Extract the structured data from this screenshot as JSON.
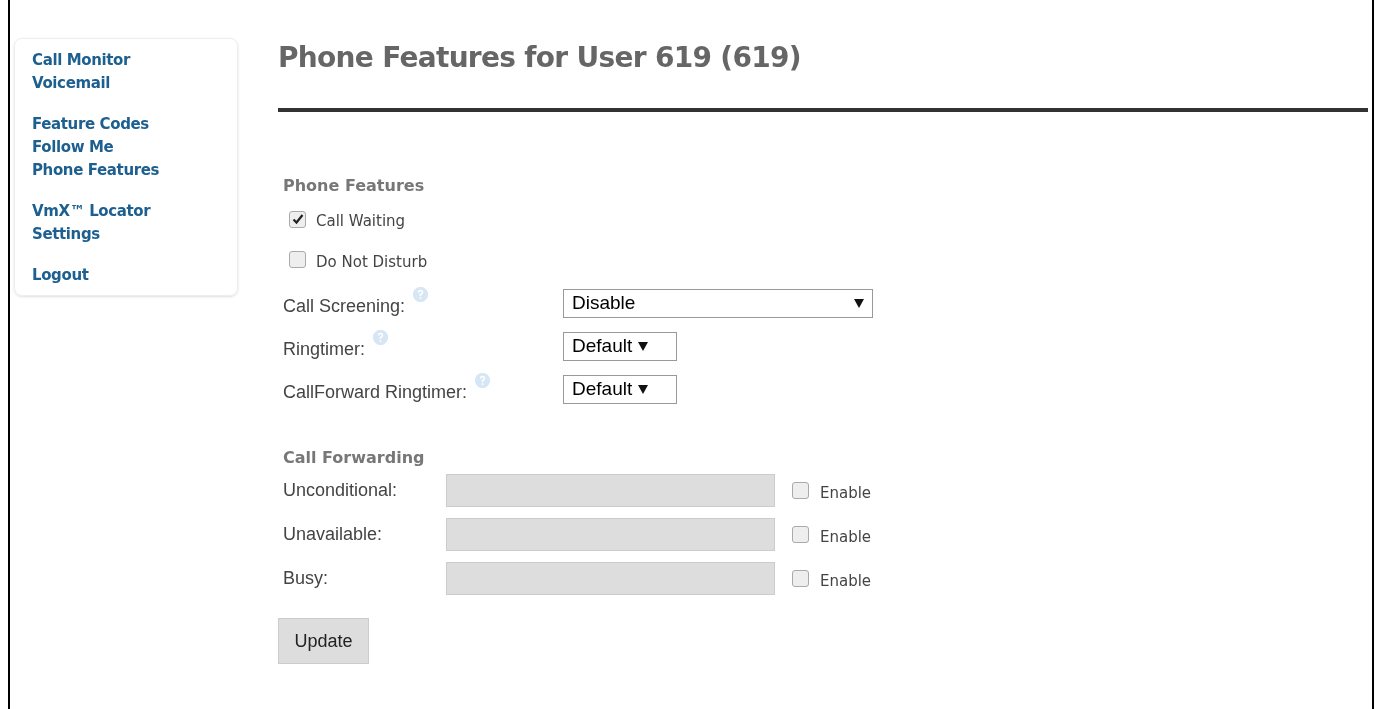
{
  "sidebar": {
    "groups": [
      {
        "items": [
          {
            "label": "Call Monitor"
          },
          {
            "label": "Voicemail"
          }
        ]
      },
      {
        "items": [
          {
            "label": "Feature Codes"
          },
          {
            "label": "Follow Me"
          },
          {
            "label": "Phone Features"
          }
        ]
      },
      {
        "items": [
          {
            "label": "VmX™ Locator"
          },
          {
            "label": "Settings"
          }
        ]
      },
      {
        "items": [
          {
            "label": "Logout"
          }
        ]
      }
    ]
  },
  "page_title": "Phone Features for User 619 (619)",
  "phone_features": {
    "heading": "Phone Features",
    "checkboxes": [
      {
        "label": "Call Waiting",
        "checked": true
      },
      {
        "label": "Do Not Disturb",
        "checked": false
      }
    ],
    "selects": [
      {
        "label": "Call Screening:",
        "value": "Disable",
        "wide": true
      },
      {
        "label": "Ringtimer:",
        "value": "Default",
        "wide": false
      },
      {
        "label": "CallForward Ringtimer:",
        "value": "Default",
        "wide": false
      }
    ]
  },
  "call_forwarding": {
    "heading": "Call Forwarding",
    "rows": [
      {
        "label": "Unconditional:",
        "enable_label": "Enable",
        "enabled": false
      },
      {
        "label": "Unavailable:",
        "enable_label": "Enable",
        "enabled": false
      },
      {
        "label": "Busy:",
        "enable_label": "Enable",
        "enabled": false
      }
    ]
  },
  "update_button": "Update"
}
